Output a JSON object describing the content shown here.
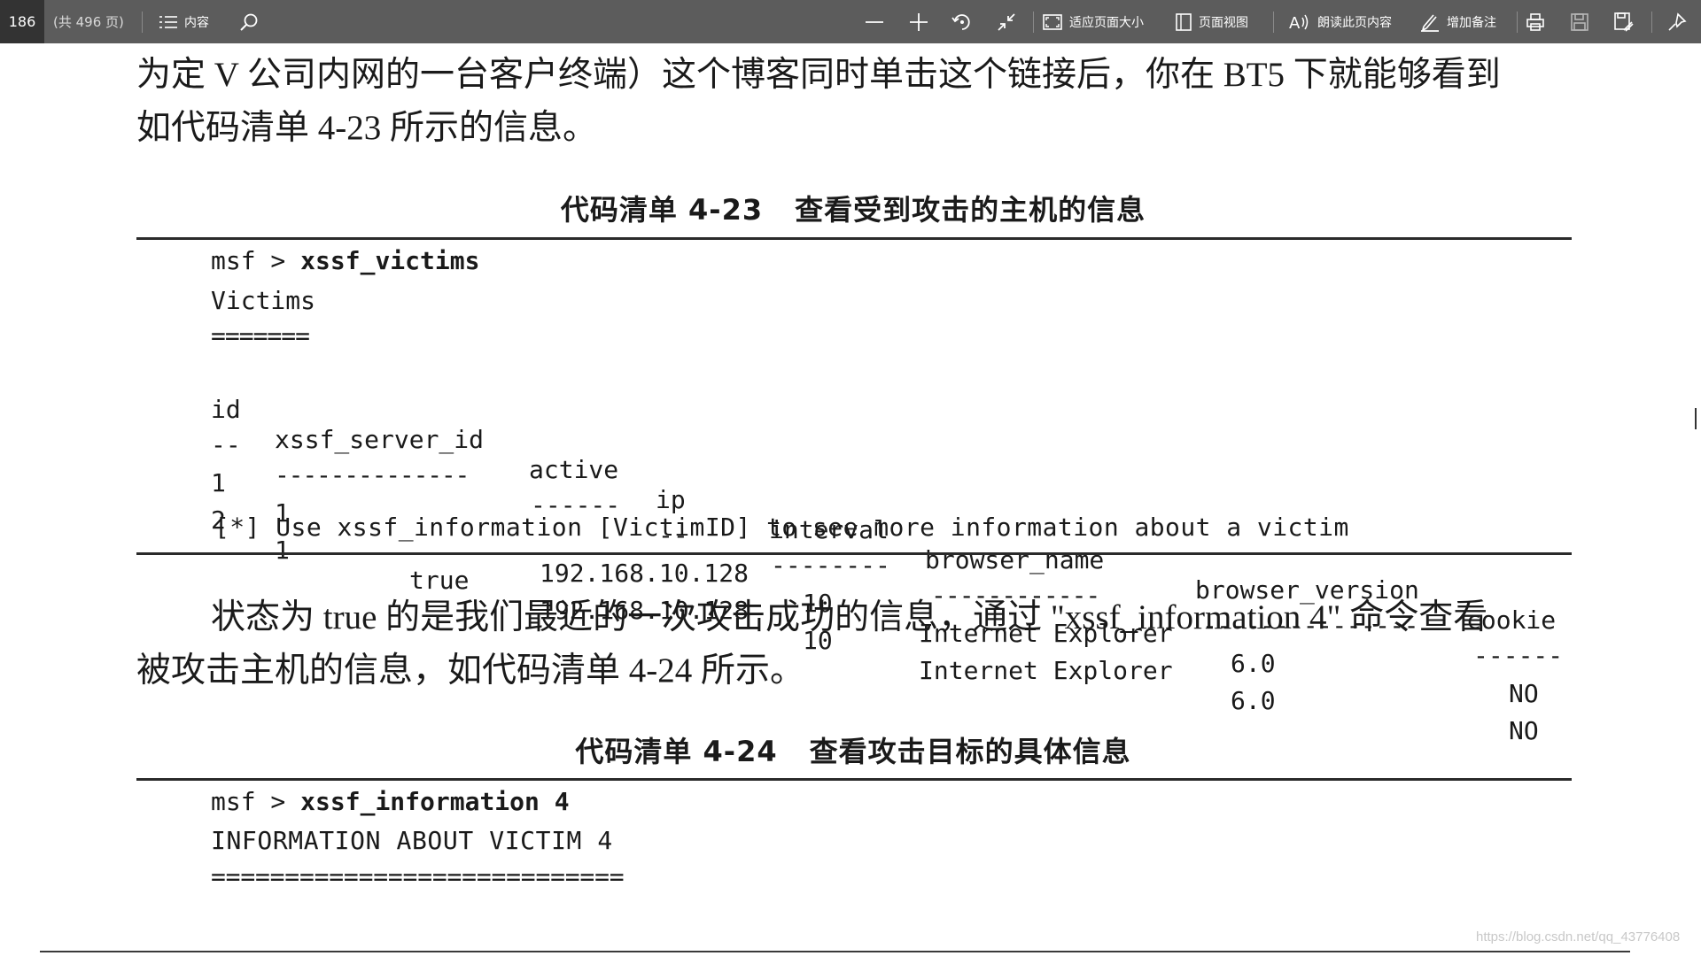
{
  "toolbar": {
    "page_number": "186",
    "page_total": "(共 496 页)",
    "contents_label": "内容",
    "fit_page_label": "适应页面大小",
    "page_view_label": "页面视图",
    "read_aloud_label": "朗读此页内容",
    "add_note_label": "增加备注",
    "icons": [
      "menu-icon",
      "search-icon",
      "zoom-out-icon",
      "zoom-in-icon",
      "rotate-icon",
      "collapse-icon",
      "fit-page-icon",
      "page-view-icon",
      "read-aloud-icon",
      "pen-icon",
      "print-icon",
      "save-icon",
      "save-as-icon",
      "pin-icon"
    ]
  },
  "document": {
    "para1_line1": "为定 V 公司内网的一台客户终端）这个博客同时单击这个链接后，你在 BT5 下就能够看到",
    "para1_line2": "如代码清单 4-23 所示的信息。",
    "caption1_number": "代码清单 4-23",
    "caption1_title": "查看受到攻击的主机的信息",
    "code1": {
      "prompt": "msf > ",
      "command": "xssf_victims",
      "title": "Victims",
      "title_underline": "=======",
      "columns": [
        "id",
        "xssf_server_id",
        "active",
        "ip",
        "interval",
        "browser_name",
        "browser_version",
        "cookie"
      ],
      "column_dashes": [
        "--",
        "--------------",
        "------",
        "--",
        "--------",
        "------------",
        "---------------",
        "------"
      ],
      "rows": [
        {
          "id": "1",
          "xssf_server_id": "1",
          "active": "",
          "ip": "192.168.10.128",
          "interval": "10",
          "browser_name": "Internet Explorer",
          "browser_version": "6.0",
          "cookie": "NO"
        },
        {
          "id": "2",
          "xssf_server_id": "1",
          "active": "true",
          "ip": "192.168.10.128",
          "interval": "10",
          "browser_name": "Internet Explorer",
          "browser_version": "6.0",
          "cookie": "NO"
        }
      ],
      "hint": "[*] Use xssf_information [VictimID] to see more information about a victim"
    },
    "para2_line1": "状态为 true 的是我们最近的一次攻击成功的信息，通过 \"xssf_information 4\" 命令查看",
    "para2_line2": "被攻击主机的信息，如代码清单 4-24 所示。",
    "caption2_number": "代码清单 4-24",
    "caption2_title": "查看攻击目标的具体信息",
    "code2": {
      "prompt": "msf > ",
      "command": "xssf_information 4",
      "title": "INFORMATION ABOUT VICTIM 4",
      "underline": "============================"
    }
  },
  "watermark": "https://blog.csdn.net/qq_43776408"
}
